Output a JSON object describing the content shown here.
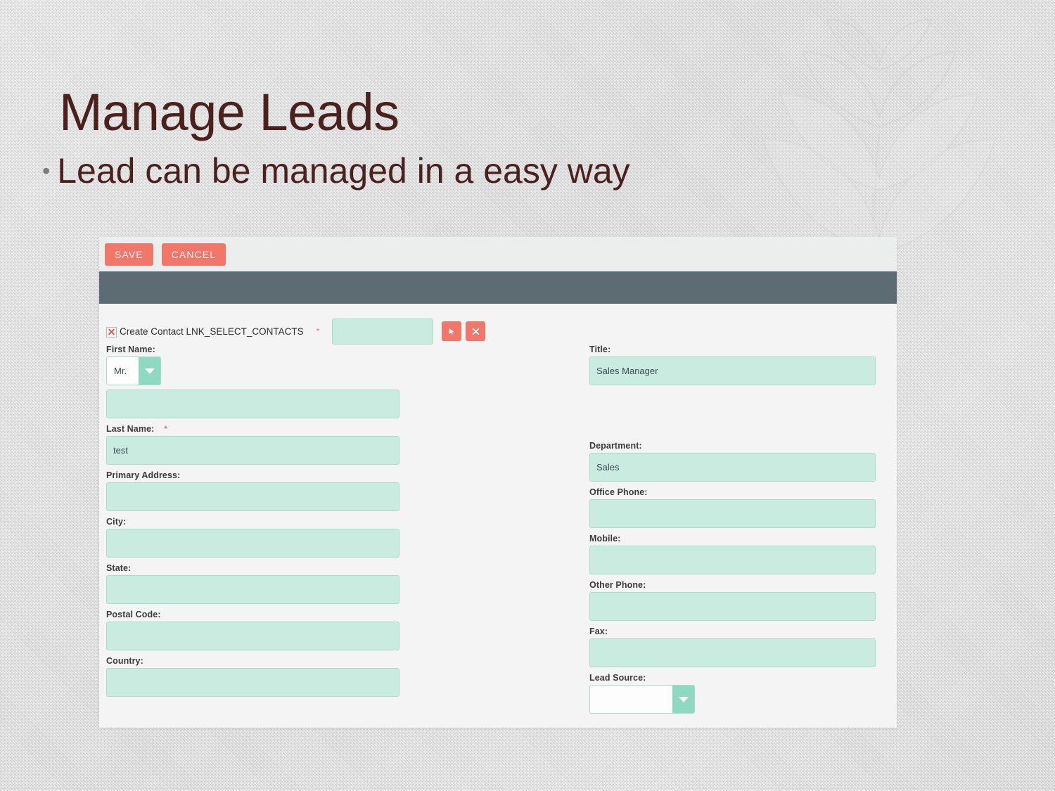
{
  "slide": {
    "title": "Manage Leads",
    "bullet": "Lead can be managed in a easy way",
    "bullet_marker": "•",
    "title_color": "#4a211c"
  },
  "app": {
    "toolbar": {
      "save_label": "SAVE",
      "cancel_label": "CANCEL",
      "button_color": "#f1776a"
    },
    "module_bar": {
      "color": "#5d6b73",
      "title": ""
    },
    "create_contact": {
      "icon": "broken-image-icon",
      "label": "Create Contact LNK_SELECT_CONTACTS",
      "required_marker": "*",
      "lookup_value": "",
      "select_button_icon": "cursor-arrow-icon",
      "select_button_glyph": "➤",
      "clear_button_icon": "close-x-icon",
      "clear_button_glyph": "✕"
    },
    "form": {
      "left_fields": [
        {
          "name": "first-name",
          "label": "First Name:",
          "required": false,
          "type": "salutation-and-text",
          "salutation_value": "Mr.",
          "value": ""
        },
        {
          "name": "last-name",
          "label": "Last Name:",
          "required": true,
          "required_marker": "*",
          "type": "text",
          "value": "test"
        },
        {
          "name": "primary-address",
          "label": "Primary Address:",
          "required": false,
          "type": "text",
          "value": ""
        },
        {
          "name": "city",
          "label": "City:",
          "required": false,
          "type": "text",
          "value": ""
        },
        {
          "name": "state",
          "label": "State:",
          "required": false,
          "type": "text",
          "value": ""
        },
        {
          "name": "postal-code",
          "label": "Postal Code:",
          "required": false,
          "type": "text",
          "value": ""
        },
        {
          "name": "country",
          "label": "Country:",
          "required": false,
          "type": "text",
          "value": ""
        }
      ],
      "right_fields": [
        {
          "name": "title",
          "label": "Title:",
          "required": false,
          "type": "text",
          "value": "Sales Manager"
        },
        {
          "name": "department",
          "label": "Department:",
          "required": false,
          "type": "text",
          "value": "Sales"
        },
        {
          "name": "office-phone",
          "label": "Office Phone:",
          "required": false,
          "type": "text",
          "value": ""
        },
        {
          "name": "mobile",
          "label": "Mobile:",
          "required": false,
          "type": "text",
          "value": ""
        },
        {
          "name": "other-phone",
          "label": "Other Phone:",
          "required": false,
          "type": "text",
          "value": ""
        },
        {
          "name": "fax",
          "label": "Fax:",
          "required": false,
          "type": "text",
          "value": ""
        },
        {
          "name": "lead-source",
          "label": "Lead Source:",
          "required": false,
          "type": "select",
          "value": ""
        }
      ],
      "field_fill_color": "#c9ebe0",
      "field_border_color": "#a8ddcd",
      "select_arrow_color": "#8fd9c2"
    }
  }
}
